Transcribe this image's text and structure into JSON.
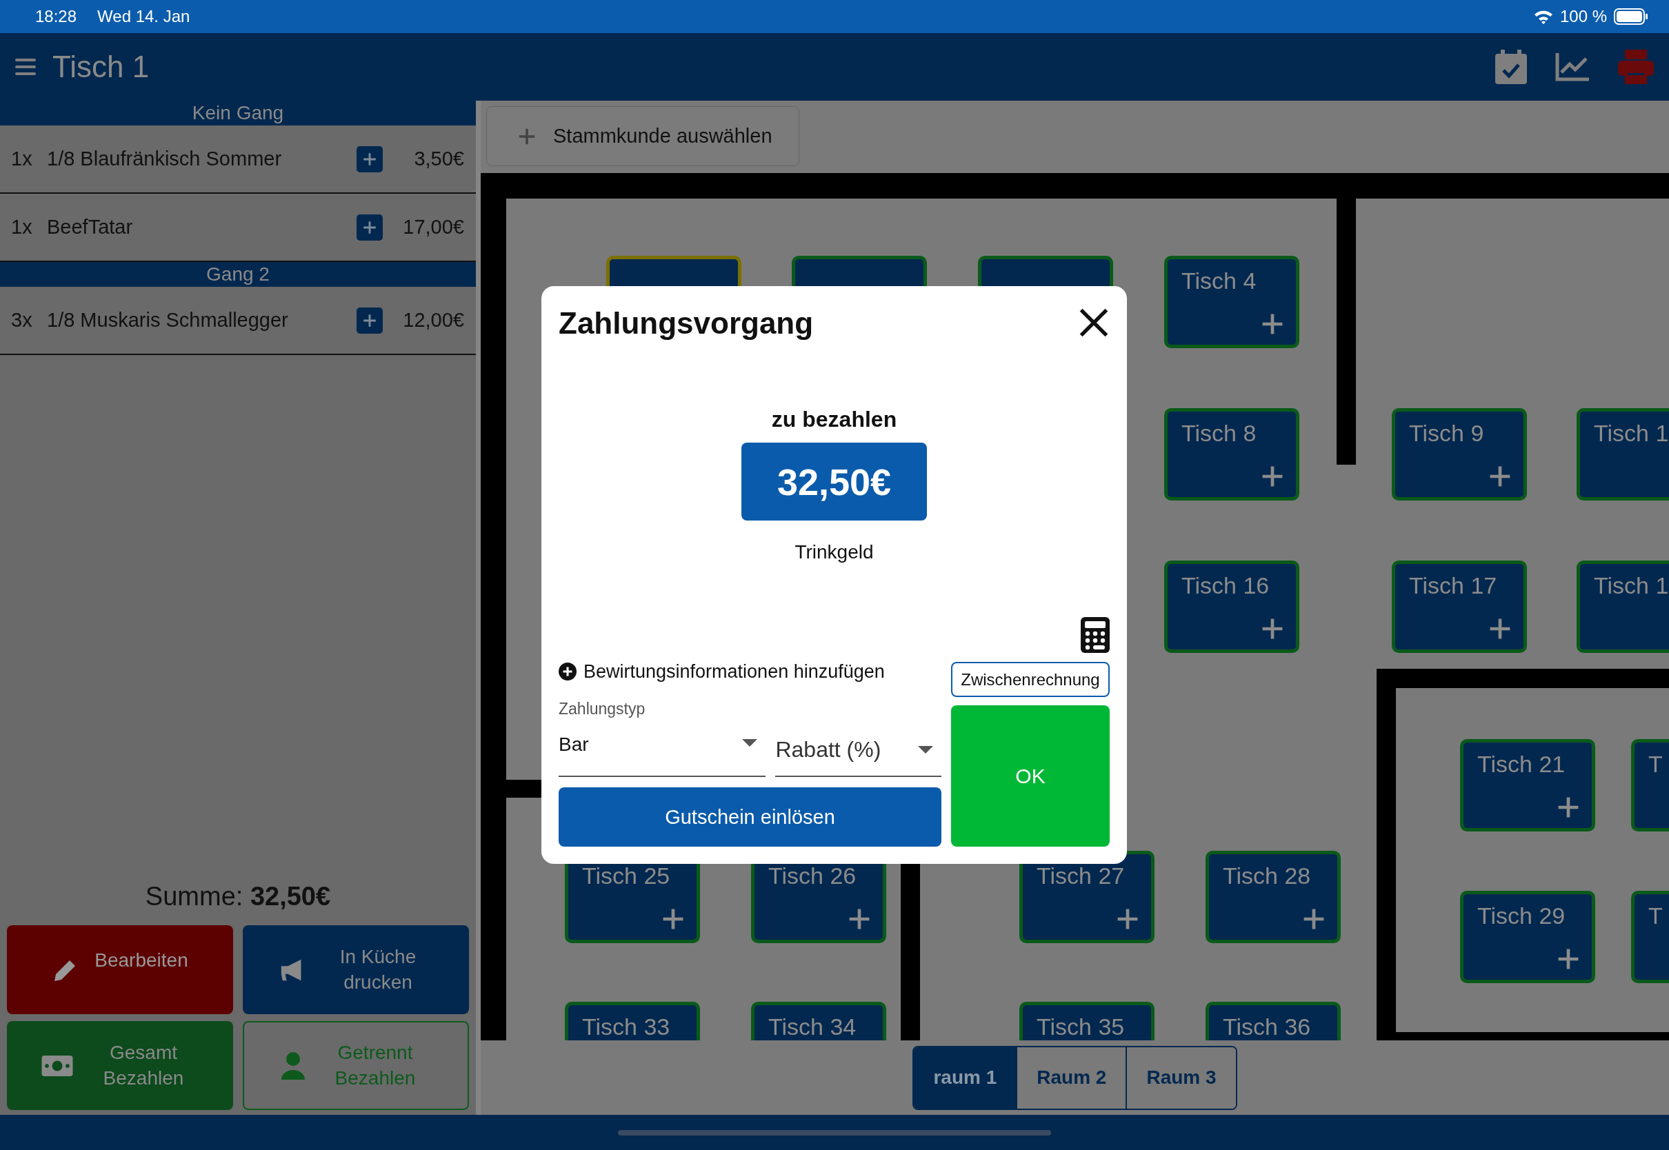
{
  "status_bar": {
    "time": "18:28",
    "date": "Wed 14. Jan",
    "battery": "100 %"
  },
  "header": {
    "title": "Tisch 1"
  },
  "order": {
    "courses": [
      {
        "name": "Kein Gang",
        "items": [
          {
            "qty": "1x",
            "name": "1/8 Blaufränkisch Sommer",
            "price": "3,50€"
          },
          {
            "qty": "1x",
            "name": "BeefTatar",
            "price": "17,00€"
          }
        ]
      },
      {
        "name": "Gang 2",
        "items": [
          {
            "qty": "3x",
            "name": "1/8 Muskaris Schmallegger",
            "price": "12,00€"
          }
        ]
      }
    ],
    "total": "Summe: **32,50€**"
  },
  "actions": [
    {
      "kind": "edit",
      "label": "Bearbeiten"
    },
    {
      "kind": "kitchen",
      "label": "In Küche drucken"
    },
    {
      "kind": "pay_all",
      "label": "Gesamt Bezahlen"
    },
    {
      "kind": "pay_split",
      "label": "Getrennt Bezahlen"
    }
  ],
  "customer_button": {
    "label": "Stammkunde auswählen"
  },
  "tables": [
    {
      "selected": true
    },
    {
      "selected": false
    },
    {
      "selected": false
    },
    {
      "label": "Tisch 4",
      "selected": false
    },
    {
      "label": "Tisch 8",
      "selected": false
    },
    {
      "label": "Tisch 9",
      "selected": false
    },
    {
      "label": "Tisch 1",
      "selected": false
    },
    {
      "label": "Tisch 16",
      "selected": false
    },
    {
      "label": "Tisch 17",
      "selected": false
    },
    {
      "label": "Tisch 1",
      "selected": false
    },
    {
      "label": "Tisch 21",
      "selected": false
    },
    {
      "label": "T",
      "selected": false
    },
    {
      "label": "Tisch 29",
      "selected": false
    },
    {
      "label": "T",
      "selected": false
    },
    {
      "label": "Tisch 25",
      "selected": false
    },
    {
      "label": "Tisch 26",
      "selected": false
    },
    {
      "label": "Tisch 27",
      "selected": false
    },
    {
      "label": "Tisch 28",
      "selected": false
    },
    {
      "label": "Tisch 33",
      "selected": false
    },
    {
      "label": "Tisch 34",
      "selected": false
    },
    {
      "label": "Tisch 35",
      "selected": false
    },
    {
      "label": "Tisch 36",
      "selected": false
    }
  ],
  "rooms": [
    {
      "label": "raum 1",
      "selected": true
    },
    {
      "label": "Raum 2",
      "selected": false
    },
    {
      "label": "Raum 3",
      "selected": false
    }
  ],
  "dialog": {
    "title": "Zahlungsvorgang",
    "due_label": "zu bezahlen",
    "amount": "32,50€",
    "tip_label": "Trinkgeld",
    "hospitality_link": "Bewirtungsinformationen hinzufügen",
    "interim_button": "Zwischenrechnung",
    "payment_type": {
      "label": "Zahlungstyp",
      "value": "Bar"
    },
    "discount": {
      "label": "Rabatt (%)"
    },
    "voucher_button": "Gutschein einlösen",
    "ok_button": "OK"
  }
}
